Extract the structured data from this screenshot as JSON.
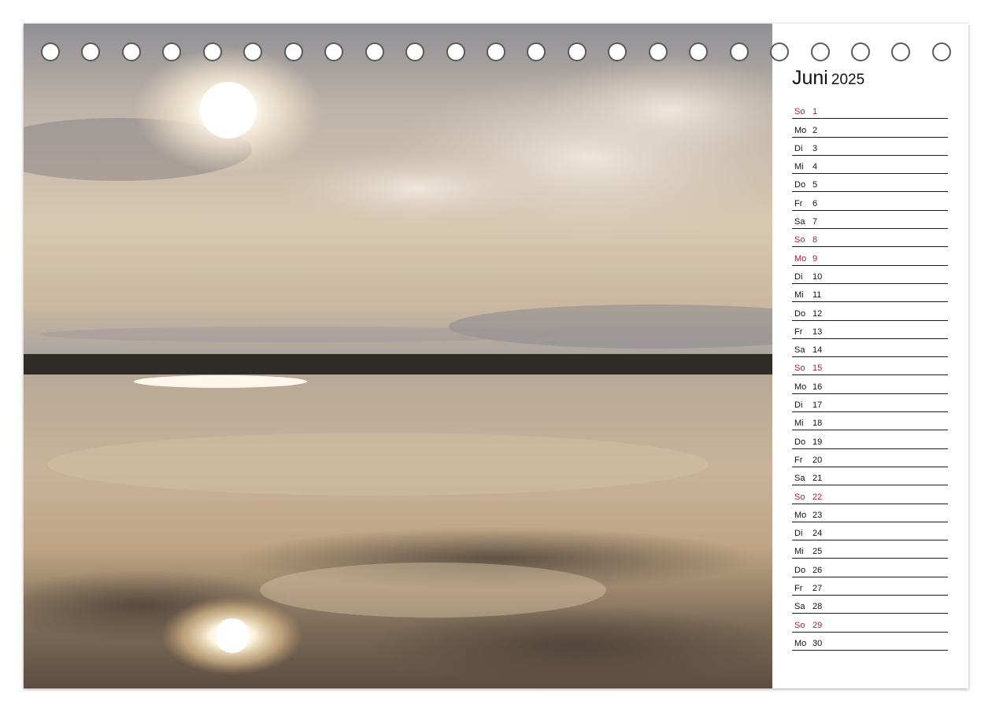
{
  "calendar": {
    "month": "Juni",
    "year": "2025",
    "holiday_color": "#b01c3a",
    "days": [
      {
        "wd": "So",
        "d": "1",
        "red": true
      },
      {
        "wd": "Mo",
        "d": "2"
      },
      {
        "wd": "Di",
        "d": "3"
      },
      {
        "wd": "Mi",
        "d": "4"
      },
      {
        "wd": "Do",
        "d": "5"
      },
      {
        "wd": "Fr",
        "d": "6"
      },
      {
        "wd": "Sa",
        "d": "7"
      },
      {
        "wd": "So",
        "d": "8",
        "red": true
      },
      {
        "wd": "Mo",
        "d": "9",
        "red": true
      },
      {
        "wd": "Di",
        "d": "10"
      },
      {
        "wd": "Mi",
        "d": "11"
      },
      {
        "wd": "Do",
        "d": "12"
      },
      {
        "wd": "Fr",
        "d": "13"
      },
      {
        "wd": "Sa",
        "d": "14"
      },
      {
        "wd": "So",
        "d": "15",
        "red": true
      },
      {
        "wd": "Mo",
        "d": "16"
      },
      {
        "wd": "Di",
        "d": "17"
      },
      {
        "wd": "Mi",
        "d": "18"
      },
      {
        "wd": "Do",
        "d": "19"
      },
      {
        "wd": "Fr",
        "d": "20"
      },
      {
        "wd": "Sa",
        "d": "21"
      },
      {
        "wd": "So",
        "d": "22",
        "red": true
      },
      {
        "wd": "Mo",
        "d": "23"
      },
      {
        "wd": "Di",
        "d": "24"
      },
      {
        "wd": "Mi",
        "d": "25"
      },
      {
        "wd": "Do",
        "d": "26"
      },
      {
        "wd": "Fr",
        "d": "27"
      },
      {
        "wd": "Sa",
        "d": "28"
      },
      {
        "wd": "So",
        "d": "29",
        "red": true
      },
      {
        "wd": "Mo",
        "d": "30"
      }
    ]
  },
  "binding": {
    "ring_count": 23
  }
}
